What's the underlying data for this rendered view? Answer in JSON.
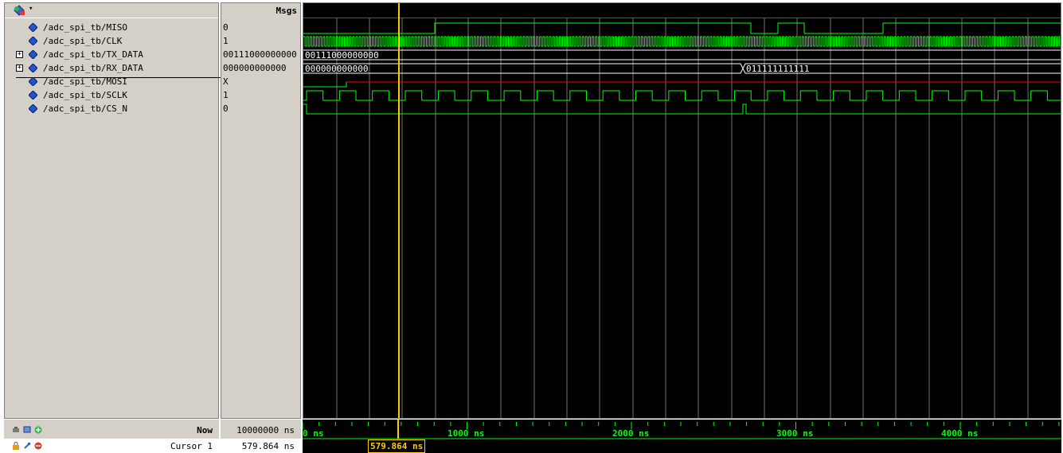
{
  "header": {
    "msgs_label": "Msgs"
  },
  "signals": [
    {
      "name": "/adc_spi_tb/MISO",
      "value": "0",
      "expandable": false
    },
    {
      "name": "/adc_spi_tb/CLK",
      "value": "1",
      "expandable": false
    },
    {
      "name": "/adc_spi_tb/TX_DATA",
      "value": "00111000000000",
      "expandable": true
    },
    {
      "name": "/adc_spi_tb/RX_DATA",
      "value": "000000000000",
      "expandable": true
    },
    {
      "name": "/adc_spi_tb/MOSI",
      "value": "X",
      "expandable": false
    },
    {
      "name": "/adc_spi_tb/SCLK",
      "value": "1",
      "expandable": false
    },
    {
      "name": "/adc_spi_tb/CS_N",
      "value": "0",
      "expandable": false
    }
  ],
  "waveform": {
    "tx_data_label": "00111000000000",
    "rx_data_label_1": "000000000000",
    "rx_data_label_2": "011111111111",
    "signal_color": "#00ff00",
    "undefined_color": "#ff0000",
    "cursor_color": "#ffcc00"
  },
  "bottom": {
    "now_label": "Now",
    "now_value": "10000000 ns",
    "cursor_label": "Cursor 1",
    "cursor_value": "579.864 ns",
    "cursor_box": "579.864 ns"
  },
  "timeline": {
    "labels": [
      "0 ns",
      "1000 ns",
      "2000 ns",
      "3000 ns",
      "4000 ns"
    ]
  },
  "icons": {
    "toolbar": "wave-toolbar-icon",
    "signal": "diamond-signal-icon",
    "now_icons": [
      "zoom-icon",
      "screen-icon",
      "add-icon"
    ],
    "cursor_icons": [
      "lock-icon",
      "wrench-icon",
      "remove-icon"
    ]
  }
}
